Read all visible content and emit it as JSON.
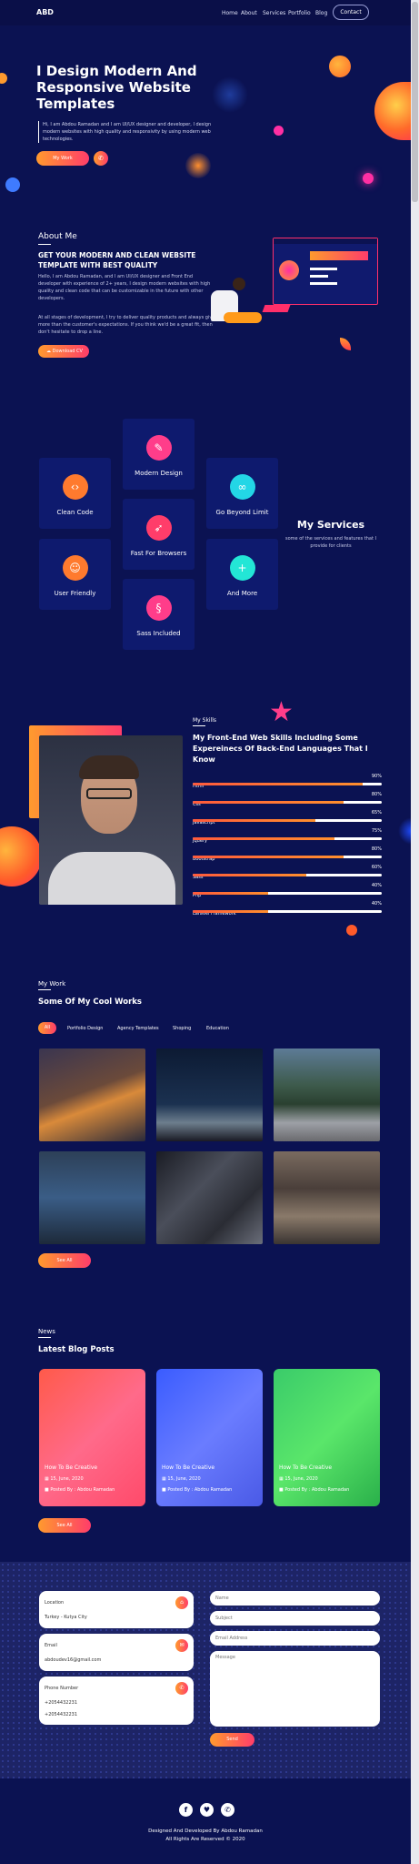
{
  "nav": {
    "logo": "ABD",
    "links": [
      "Home",
      "About",
      "Services",
      "Portfolio",
      "Blog"
    ],
    "contact": "Contact"
  },
  "hero": {
    "title_lines": [
      "I Design Modern And",
      "Responsive Website",
      "Templates"
    ],
    "desc": "Hi, I am Abdou Ramadan and I am UI/UX designer and developer, I design modern websites with high quality and responsivity by using modern web technologies.",
    "button": "My Work"
  },
  "about": {
    "label": "About Me",
    "heading": "GET YOUR MODERN AND CLEAN WEBSITE TEMPLATE WITH BEST QUALITY",
    "p1": "Hello, I am Abdou Ramadan, and I am UI/UX designer and Front End developer with experience of 2+ years, I design modern websites with high quality and clean code that can be customizable in the future with other developers.",
    "p2": "At all stages of development, I try to deliver quality products and always give more than the customer's expectations. If you think we'd be a great fit, then don't hesitate to drop a line.",
    "button": "Download CV"
  },
  "services": {
    "title": "My Services",
    "desc": "some of the services and features that I provide for clients",
    "items": [
      "Modern Design",
      "Clean Code",
      "Go Beyond Limit",
      "Fast For Browsers",
      "User Friendly",
      "And More",
      "Sass Included"
    ]
  },
  "skills": {
    "label": "My Skills",
    "heading": "My Front-End Web Skills Including Some Expereinecs Of Back-End Languages That I Know",
    "list": [
      {
        "name": "Html",
        "pct": "90%",
        "value": 90
      },
      {
        "name": "Css",
        "pct": "80%",
        "value": 80
      },
      {
        "name": "Javascript",
        "pct": "65%",
        "value": 65
      },
      {
        "name": "Jquery",
        "pct": "75%",
        "value": 75
      },
      {
        "name": "Bootstrap",
        "pct": "80%",
        "value": 80
      },
      {
        "name": "Sass",
        "pct": "60%",
        "value": 60
      },
      {
        "name": "Php",
        "pct": "40%",
        "value": 40
      },
      {
        "name": "Laravel Framework",
        "pct": "40%",
        "value": 40
      }
    ]
  },
  "work": {
    "label": "My Work",
    "heading": "Some Of My Cool Works",
    "filters": [
      "All",
      "Portfolio Design",
      "Agency Templates",
      "Shoping",
      "Education"
    ],
    "button": "See All"
  },
  "blog": {
    "label": "News",
    "heading": "Latest Blog Posts",
    "posts": [
      {
        "title": "How To Be Creative",
        "date": "15, June, 2020",
        "author": "Posted By : Abdou Ramadan"
      },
      {
        "title": "How To Be Creative",
        "date": "15, June, 2020",
        "author": "Posted By : Abdou Ramadan"
      },
      {
        "title": "How To Be Creative",
        "date": "15, June, 2020",
        "author": "Posted By : Abdou Ramadan"
      }
    ],
    "button": "See All"
  },
  "contact": {
    "location_label": "Location",
    "location": "Turkey - Kutya City",
    "email_label": "Email",
    "email": "abdoudev16@gmail.com",
    "phone_label": "Phone Number",
    "phone1": "+2054432231",
    "phone2": "+2054432231",
    "ph_name": "Name",
    "ph_subject": "Subject",
    "ph_email": "Email Address",
    "ph_message": "Message",
    "send": "Send"
  },
  "footer": {
    "line1": "Designed And Developed By Abdou Ramadan",
    "line2": "All Rights Are Reserved © 2020"
  }
}
